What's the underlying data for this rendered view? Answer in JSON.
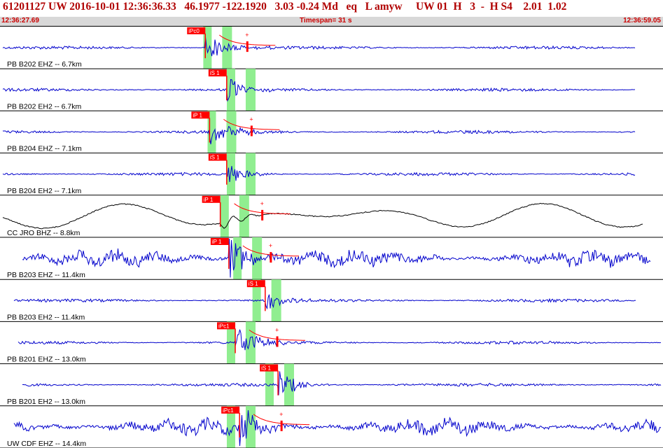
{
  "header": {
    "event_line": "61201127 UW 2016-10-01 12:36:36.33   46.1977 -122.1920   3.03 -0.24 Md   eq   L amyw     UW 01  H   3  -  H S4    2.01  1.02"
  },
  "time_bar": {
    "start": "12:36:27.69",
    "timespan": "Timespan=  31 s",
    "end": "12:36:59.05"
  },
  "colors": {
    "header_text": "#b00000",
    "trace": "#0000cc",
    "trace_alt": "#000000",
    "pick_marker": "#ff0000",
    "window_highlight": "#90ee90",
    "separator": "#000000"
  },
  "traces": [
    {
      "label": "PB B202 EHZ -- 6.7km",
      "pick": "iPc0",
      "pick_time": 9.6,
      "amp": 0.6,
      "color": "trace",
      "coda": true,
      "window": 9.8
    },
    {
      "label": "PB B202 EH2 -- 6.7km",
      "pick": "iS 1",
      "pick_time": 10.6,
      "amp": 0.6,
      "color": "trace",
      "coda": false,
      "window": 10.9
    },
    {
      "label": "PB B204 EHZ -- 7.1km",
      "pick": "iP 1",
      "pick_time": 9.8,
      "amp": 0.6,
      "color": "trace",
      "coda": true,
      "window": 10.0
    },
    {
      "label": "PB B204 EH2 -- 7.1km",
      "pick": "iS 1",
      "pick_time": 10.6,
      "amp": 0.6,
      "color": "trace",
      "coda": false,
      "window": 10.9
    },
    {
      "label": "CC JRO BHZ -- 8.8km",
      "pick": "iP 1",
      "pick_time": 10.3,
      "amp": 0.4,
      "color": "trace_alt",
      "coda": true,
      "window": 10.6
    },
    {
      "label": "PB B203 EHZ -- 11.4km",
      "pick": "iP 1",
      "pick_time": 10.7,
      "amp": 1.0,
      "color": "trace",
      "coda": true,
      "window": 11.2
    },
    {
      "label": "PB B203 EH2 -- 11.4km",
      "pick": "iS 1",
      "pick_time": 12.4,
      "amp": 0.5,
      "color": "trace",
      "coda": false,
      "window": 12.1
    },
    {
      "label": "PB B201 EHZ -- 13.0km",
      "pick": "iPc1",
      "pick_time": 11.0,
      "amp": 0.8,
      "color": "trace",
      "coda": true,
      "window": 10.9
    },
    {
      "label": "PB B201 EH2 -- 13.0km",
      "pick": "iS 1",
      "pick_time": 13.0,
      "amp": 0.8,
      "color": "trace",
      "coda": false,
      "window": 12.7
    },
    {
      "label": "UW CDF EHZ -- 14.4km",
      "pick": "iPc1",
      "pick_time": 11.2,
      "amp": 0.9,
      "color": "trace",
      "coda": true,
      "window": 10.9
    }
  ]
}
